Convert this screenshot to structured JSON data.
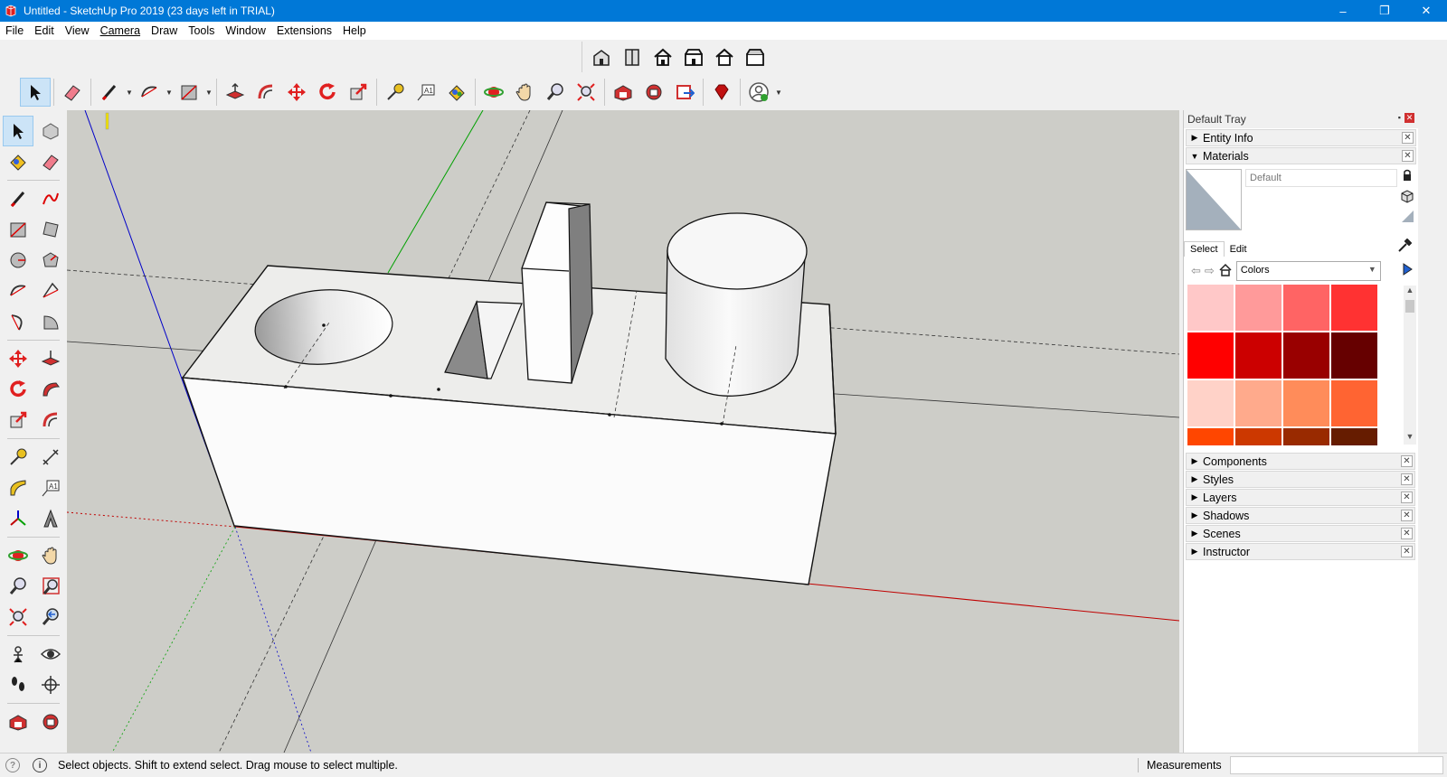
{
  "window": {
    "title": "Untitled - SketchUp Pro 2019 (23 days left in TRIAL)",
    "controls": {
      "minimize": "–",
      "maximize": "❐",
      "close": "✕"
    }
  },
  "menu": [
    "File",
    "Edit",
    "View",
    "Camera",
    "Draw",
    "Tools",
    "Window",
    "Extensions",
    "Help"
  ],
  "views_toolbar": [
    "iso-view-icon",
    "top-view-icon",
    "front-view-icon",
    "right-view-icon",
    "back-view-icon",
    "left-view-icon"
  ],
  "main_toolbar": {
    "tools": [
      "select-icon",
      "eraser-icon",
      "line-icon",
      "arc-icon",
      "rectangle-icon",
      "push-pull-icon",
      "offset-icon",
      "move-icon",
      "rotate-icon",
      "scale-icon",
      "tape-measure-icon",
      "text-icon",
      "paint-bucket-icon",
      "orbit-icon",
      "pan-icon",
      "zoom-icon",
      "zoom-extents-icon",
      "warehouse-icon",
      "extension-warehouse-icon",
      "send-to-layout-icon",
      "ruby-console-icon",
      "account-icon"
    ]
  },
  "viewport": {
    "axis_colors": {
      "red": "#c00000",
      "green": "#00a000",
      "blue": "#0000c8"
    },
    "background": "#cdcdc8"
  },
  "tray": {
    "title": "Default Tray",
    "panels_top": [
      {
        "label": "Entity Info",
        "expanded": false
      },
      {
        "label": "Materials",
        "expanded": true
      }
    ],
    "materials": {
      "material_name_placeholder": "Default",
      "tabs": [
        "Select",
        "Edit"
      ],
      "active_tab": "Select",
      "library": "Colors",
      "swatches": [
        "#ffc8c8",
        "#ff9a9a",
        "#ff6464",
        "#ff3232",
        "#ff0000",
        "#cc0000",
        "#990000",
        "#660000",
        "#ffd2c8",
        "#ffaa8c",
        "#ff8c5a",
        "#ff6432",
        "#ff4600",
        "#cc3800",
        "#992a00",
        "#661c00"
      ]
    },
    "panels_bottom": [
      "Components",
      "Styles",
      "Layers",
      "Shadows",
      "Scenes",
      "Instructor"
    ]
  },
  "status": {
    "message": "Select objects. Shift to extend select. Drag mouse to select multiple.",
    "measurements_label": "Measurements",
    "measurements_value": ""
  }
}
